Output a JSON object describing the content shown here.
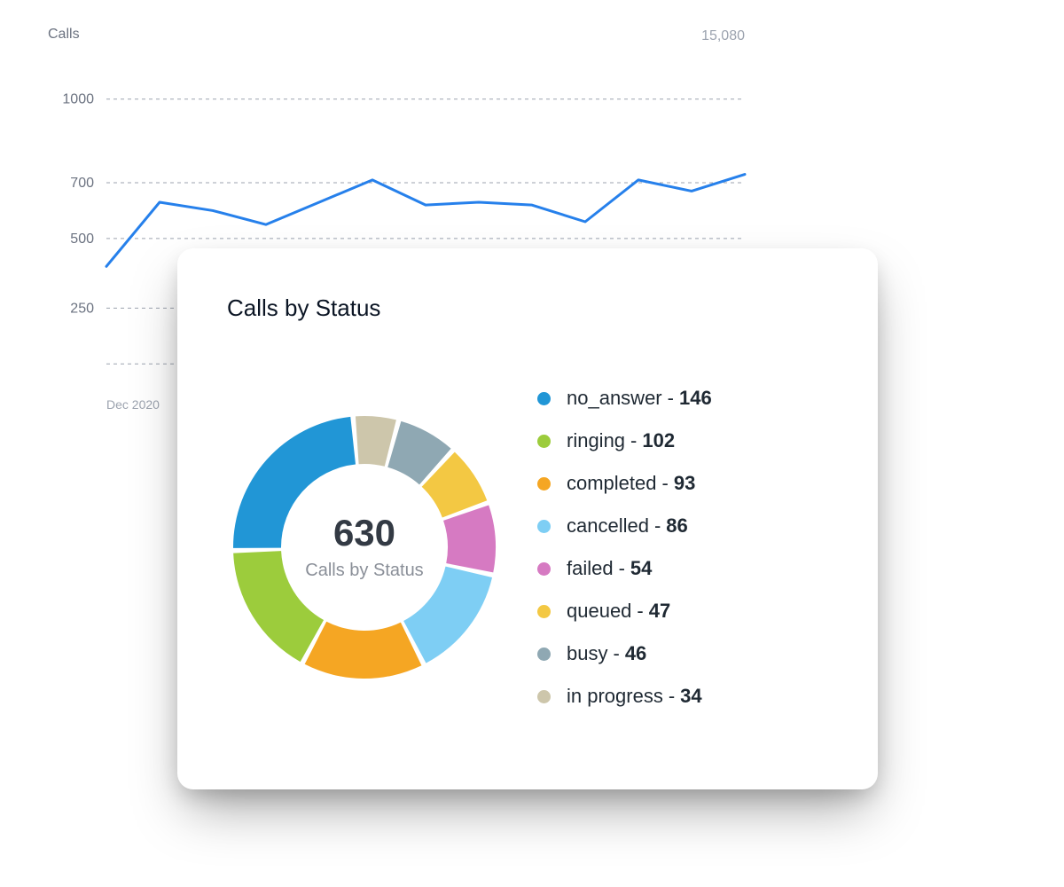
{
  "line_chart": {
    "ylabel": "Calls",
    "total": "15,080",
    "y_ticks": [
      1000,
      700,
      500,
      250
    ],
    "x_tick": "Dec 2020"
  },
  "card": {
    "title": "Calls by Status",
    "total": "630",
    "subtitle": "Calls by Status"
  },
  "legend": {
    "items": [
      {
        "label": "no_answer",
        "value": "146"
      },
      {
        "label": "ringing",
        "value": "102"
      },
      {
        "label": "completed",
        "value": "93"
      },
      {
        "label": "cancelled",
        "value": "86"
      },
      {
        "label": "failed",
        "value": "54"
      },
      {
        "label": "queued",
        "value": "47"
      },
      {
        "label": "busy",
        "value": "46"
      },
      {
        "label": "in progress",
        "value": "34"
      }
    ]
  },
  "colors": {
    "no_answer": "#2196d6",
    "ringing": "#9ccc3c",
    "completed": "#f5a623",
    "cancelled": "#7ecef4",
    "failed": "#d67ac2",
    "queued": "#f3c843",
    "busy": "#8fa8b3",
    "in_progress": "#cdc6ab"
  },
  "chart_data": [
    {
      "type": "line",
      "title": "",
      "ylabel": "Calls",
      "xlabel": "",
      "y_ticks": [
        250,
        500,
        700,
        1000
      ],
      "ylim": [
        0,
        1050
      ],
      "x": [
        0,
        1,
        2,
        3,
        4,
        5,
        6,
        7,
        8,
        9,
        10,
        11
      ],
      "values": [
        400,
        630,
        600,
        550,
        630,
        710,
        620,
        630,
        620,
        560,
        710,
        670,
        730
      ],
      "x_tick_labels": [
        "Dec 2020"
      ],
      "total": 15080
    },
    {
      "type": "pie",
      "title": "Calls by Status",
      "total": 630,
      "series": [
        {
          "name": "no_answer",
          "value": 146,
          "color": "#2196d6"
        },
        {
          "name": "ringing",
          "value": 102,
          "color": "#9ccc3c"
        },
        {
          "name": "completed",
          "value": 93,
          "color": "#f5a623"
        },
        {
          "name": "cancelled",
          "value": 86,
          "color": "#7ecef4"
        },
        {
          "name": "failed",
          "value": 54,
          "color": "#d67ac2"
        },
        {
          "name": "queued",
          "value": 47,
          "color": "#f3c843"
        },
        {
          "name": "busy",
          "value": 46,
          "color": "#8fa8b3"
        },
        {
          "name": "in progress",
          "value": 34,
          "color": "#cdc6ab"
        }
      ]
    }
  ]
}
